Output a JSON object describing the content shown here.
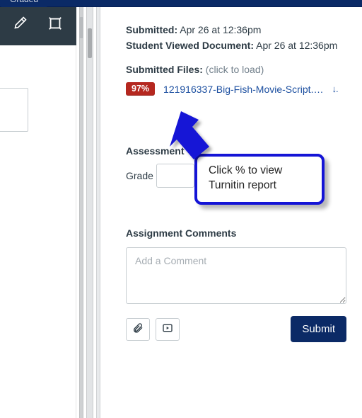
{
  "topbar": {
    "tab_label": "Graded"
  },
  "meta": {
    "submitted_label": "Submitted:",
    "submitted_value": "Apr 26 at 12:36pm",
    "viewed_label": "Student Viewed Document:",
    "viewed_value": "Apr 26 at 12:36pm",
    "files_label": "Submitted Files:",
    "files_hint": "(click to load)"
  },
  "file": {
    "similarity_pct": "97%",
    "name": "121916337-Big-Fish-Movie-Script.…"
  },
  "assessment": {
    "heading": "Assessment",
    "grade_label": "Grade",
    "grade_value": ""
  },
  "comments": {
    "heading": "Assignment Comments",
    "placeholder": "Add a Comment"
  },
  "actions": {
    "submit_label": "Submit"
  },
  "callout": {
    "text": "Click % to view Turnitin report"
  }
}
